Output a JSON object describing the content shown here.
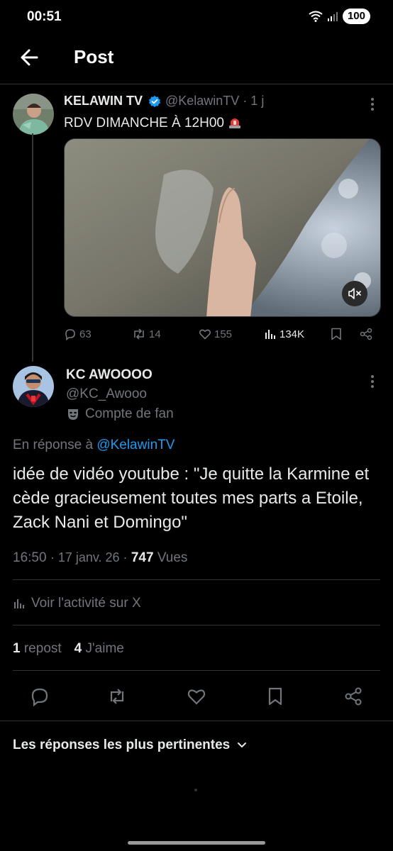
{
  "status_bar": {
    "time": "00:51",
    "battery": "100"
  },
  "header": {
    "title": "Post"
  },
  "parent_tweet": {
    "name": "KELAWIN TV",
    "handle": "@KelawinTV",
    "age": "· 1 j",
    "text": "RDV DIMANCHE À 12H00",
    "replies": "63",
    "reposts": "14",
    "likes": "155",
    "views": "134K"
  },
  "reply_tweet": {
    "name": "KC AWOOOO",
    "handle": "@KC_Awooo",
    "fan_label": "Compte de fan",
    "reply_prefix": "En réponse à",
    "reply_mention": "@KelawinTV",
    "text": "idée de vidéo youtube : \"Je quitte la Karmine et cède gracieusement toutes mes parts a Etoile, Zack Nani et Domingo\"",
    "time": "16:50",
    "date": "· 17 janv. 26 ·",
    "views_count": "747",
    "views_label": "Vues",
    "activity_label": "Voir l'activité sur X",
    "repost_count": "1",
    "repost_label": "repost",
    "like_count": "4",
    "like_label": "J'aime"
  },
  "sort": {
    "label": "Les réponses les plus pertinentes"
  },
  "colors": {
    "accent": "#1d9bf0",
    "muted": "#71767b",
    "text": "#e7e9ea",
    "background": "#000000"
  }
}
